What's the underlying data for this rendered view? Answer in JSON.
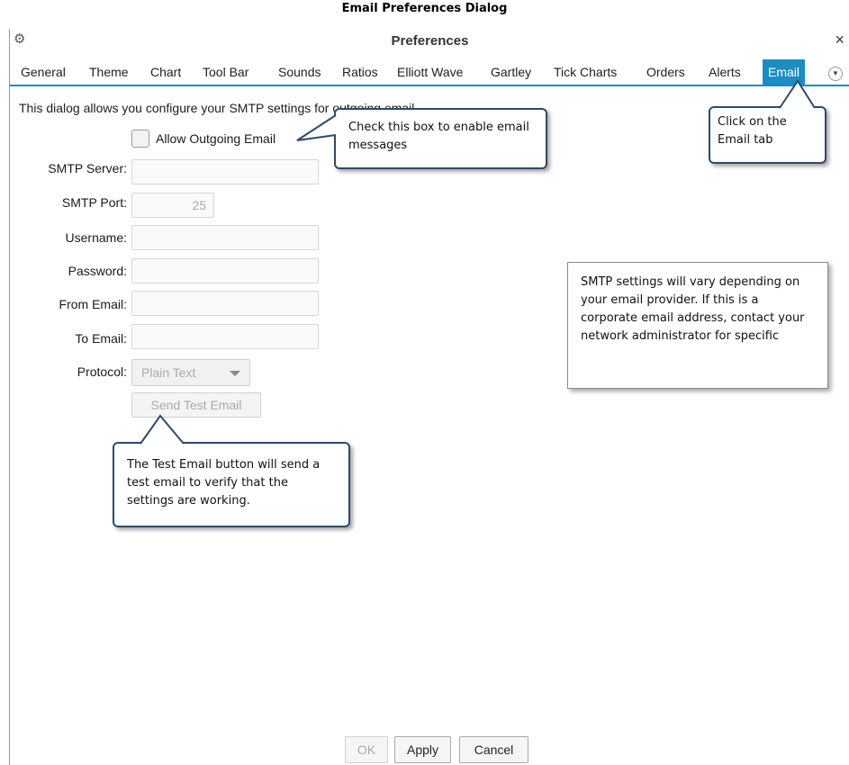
{
  "doc_title": "Email Preferences Dialog",
  "window": {
    "title": "Preferences",
    "close_glyph": "×",
    "gear_icon": "gear-icon"
  },
  "tabs": [
    "General",
    "Theme",
    "Chart",
    "Tool Bar",
    "Sounds",
    "Ratios",
    "Elliott Wave",
    "Gartley",
    "Tick Charts",
    "Orders",
    "Alerts",
    "Email"
  ],
  "active_tab": "Email",
  "intro_text": "This dialog allows you configure your SMTP settings for outgoing email.",
  "allow_outgoing_label": "Allow Outgoing Email",
  "fields": {
    "smtp_server": {
      "label": "SMTP Server:",
      "value": ""
    },
    "smtp_port": {
      "label": "SMTP Port:",
      "value": "25"
    },
    "username": {
      "label": "Username:",
      "value": ""
    },
    "password": {
      "label": "Password:",
      "value": ""
    },
    "from_email": {
      "label": "From Email:",
      "value": ""
    },
    "to_email": {
      "label": "To Email:",
      "value": ""
    },
    "protocol": {
      "label": "Protocol:",
      "value": "Plain Text"
    }
  },
  "send_test_label": "Send Test Email",
  "buttons": {
    "ok": "OK",
    "apply": "Apply",
    "cancel": "Cancel"
  },
  "callouts": {
    "checkbox": "Check this box to enable email messages",
    "email_tab": "Click on the Email tab",
    "smtp": "SMTP settings will vary depending on your email provider. If this is a corporate email address, contact your network administrator for specific",
    "test": "The Test Email button will send a test email to verify that the settings are working."
  },
  "colors": {
    "accent": "#1e8bc3",
    "callout_border": "#2e4a6a"
  }
}
